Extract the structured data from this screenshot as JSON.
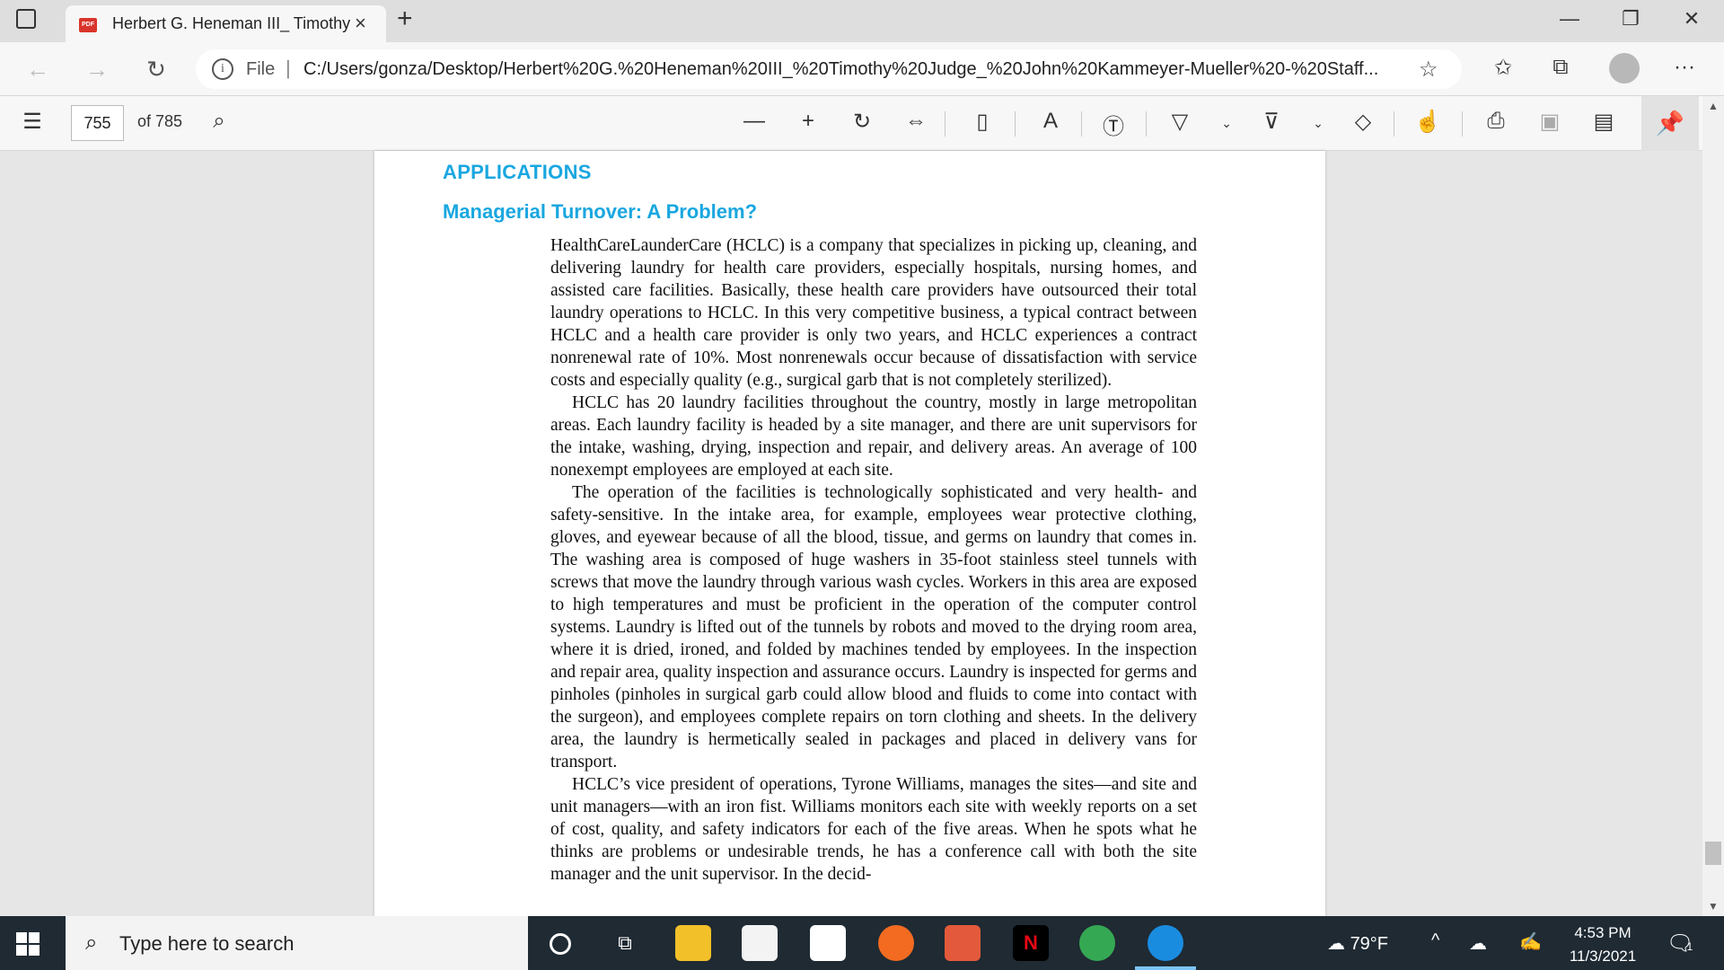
{
  "browser": {
    "tab_title": "Herbert G. Heneman III_ Timothy",
    "tab_close": "×",
    "new_tab": "+",
    "url_scheme": "File",
    "url": "C:/Users/gonza/Desktop/Herbert%20G.%20Heneman%20III_%20Timothy%20Judge_%20John%20Kammeyer-Mueller%20-%20Staff...",
    "more_label": "···"
  },
  "pdf_toolbar": {
    "current_page": "755",
    "page_count": "of 785"
  },
  "document": {
    "section_heading": "APPLICATIONS",
    "case_title": "Managerial Turnover: A Problem?",
    "paragraphs": [
      "HealthCareLaunderCare (HCLC) is a company that specializes in picking up, cleaning, and delivering laundry for health care providers, especially hospitals, nursing homes, and assisted care facilities. Basically, these health care providers have outsourced their total laundry operations to HCLC. In this very competitive business, a typical contract between HCLC and a health care provider is only two years, and HCLC experiences a contract nonrenewal rate of 10%. Most nonrenewals occur because of dissatisfaction with service costs and especially quality (e.g., surgical garb that is not completely sterilized).",
      "HCLC has 20 laundry facilities throughout the country, mostly in large metropolitan areas. Each laundry facility is headed by a site manager, and there are unit supervisors for the intake, washing, drying, inspection and repair, and delivery areas. An average of 100 nonexempt employees are employed at each site.",
      "The operation of the facilities is technologically sophisticated and very health- and safety-sensitive. In the intake area, for example, employees wear protective clothing, gloves, and eyewear because of all the blood, tissue, and germs on laundry that comes in. The washing area is composed of huge washers in 35-foot stainless steel tunnels with screws that move the laundry through various wash cycles. Workers in this area are exposed to high temperatures and must be proficient in the operation of the computer control systems. Laundry is lifted out of the tunnels by robots and moved to the drying room area, where it is dried, ironed, and folded by machines tended by employees. In the inspection and repair area, quality inspection and assurance occurs. Laundry is inspected for germs and pinholes (pinholes in surgical garb could allow blood and fluids to come into contact with the surgeon), and employees complete repairs on torn clothing and sheets. In the delivery area, the laundry is hermetically sealed in packages and placed in delivery vans for transport.",
      "HCLC’s vice president of operations, Tyrone Williams, manages the sites—and site and unit managers—with an iron fist. Williams monitors each site with weekly reports on a set of cost, quality, and safety indicators for each of the five areas. When he spots what he thinks are problems or undesirable trends, he has a conference call with both the site manager and the unit supervisor. In the decid-"
    ]
  },
  "taskbar": {
    "search_placeholder": "Type here to search",
    "weather": "79°F",
    "time": "4:53 PM",
    "date": "11/3/2021",
    "notification_count": "1",
    "netflix_letter": "N"
  },
  "colors": {
    "heading_blue": "#19a7e0",
    "taskbar": "#1f2a33"
  }
}
